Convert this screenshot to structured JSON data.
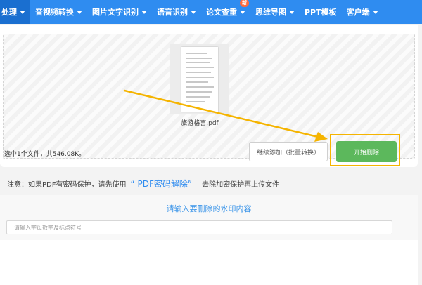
{
  "nav": {
    "items": [
      {
        "label": "处理",
        "caret": true
      },
      {
        "label": "音视频转换",
        "caret": true
      },
      {
        "label": "图片文字识别",
        "caret": true
      },
      {
        "label": "语音识别",
        "caret": true
      },
      {
        "label": "论文查重",
        "caret": true,
        "badge": "新"
      },
      {
        "label": "思维导图",
        "caret": true
      },
      {
        "label": "PPT模板",
        "caret": false
      },
      {
        "label": "客户端",
        "caret": true
      }
    ]
  },
  "upload": {
    "file_name": "旅游格言.pdf",
    "selection_info": "选中1个文件，共546.08K。",
    "continue_label": "继续添加（批量转换）",
    "start_label": "开始删除"
  },
  "notice": {
    "prefix": "注意：如果PDF有密码保护，请先使用",
    "link": "“ PDF密码解除”",
    "suffix": "去除加密保护再上传文件"
  },
  "watermark": {
    "title": "请输入要删除的水印内容",
    "placeholder": "请输入字母数字及标点符号"
  },
  "colors": {
    "nav_bg": "#2f8cf0",
    "start_button": "#5cb85c",
    "highlight": "#f5b400",
    "link": "#2f8cf0"
  }
}
